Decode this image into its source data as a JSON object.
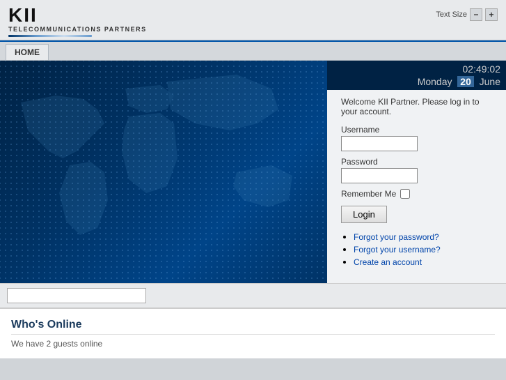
{
  "header": {
    "logo_kii": "KII",
    "logo_tagline": "TELECOMMUNICATIONS PARTNERS",
    "text_size_label": "Text Size",
    "text_size_decrease": "−",
    "text_size_increase": "+"
  },
  "nav": {
    "tabs": [
      {
        "label": "HOME",
        "active": true
      }
    ]
  },
  "datetime": {
    "time": "02:49:02",
    "day_name": "Monday",
    "day_number": "20",
    "month": "June"
  },
  "login_panel": {
    "welcome_message": "Welcome KII Partner. Please log in to your account.",
    "username_label": "Username",
    "username_placeholder": "",
    "password_label": "Password",
    "password_placeholder": "",
    "remember_me_label": "Remember Me",
    "login_button": "Login",
    "links": [
      {
        "label": "Forgot your password?"
      },
      {
        "label": "Forgot your username?"
      },
      {
        "label": "Create an account"
      }
    ]
  },
  "whos_online": {
    "title": "Who's Online",
    "message": "We have 2 guests online"
  }
}
